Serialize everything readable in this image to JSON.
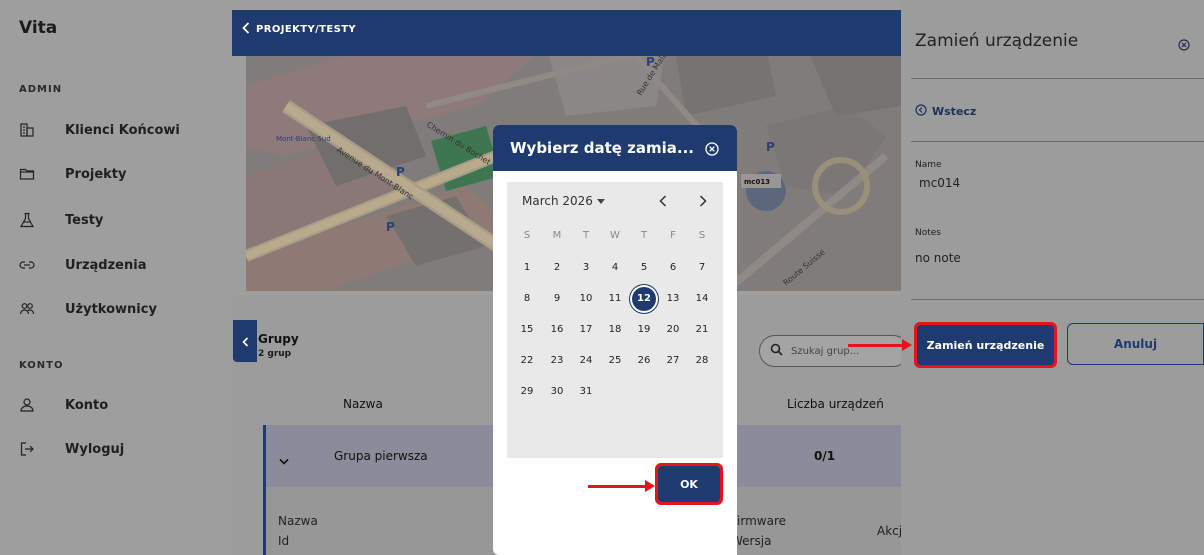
{
  "app": {
    "brand": "Vita"
  },
  "sidebar": {
    "admin_label": "ADMIN",
    "konto_label": "KONTO",
    "items": [
      {
        "label": "Klienci Końcowi",
        "icon": "building-icon"
      },
      {
        "label": "Projekty",
        "icon": "folder-icon"
      },
      {
        "label": "Testy",
        "icon": "flask-icon"
      },
      {
        "label": "Urządzenia",
        "icon": "link-icon"
      },
      {
        "label": "Użytkownicy",
        "icon": "users-icon"
      },
      {
        "label": "Konto",
        "icon": "user-icon"
      },
      {
        "label": "Wyloguj",
        "icon": "logout-icon"
      }
    ]
  },
  "header": {
    "breadcrumb": "PROJEKTY/TESTY"
  },
  "groups": {
    "title": "Grupy",
    "count": "2 grup",
    "search_placeholder": "Szukaj grup...",
    "columns": {
      "name": "Nazwa",
      "device_count": "Liczba urządzeń"
    },
    "rows": [
      {
        "name": "Grupa pierwsza",
        "count": "0/1"
      }
    ],
    "sub_columns": {
      "name": "Nazwa",
      "id": "Id",
      "firmware": "Firmware",
      "version": "Wersja",
      "actions": "Akcje"
    }
  },
  "panel": {
    "title": "Zamień urządzenie",
    "back_label": "Wstecz",
    "name_label": "Name",
    "name_value": "mc014",
    "notes_label": "Notes",
    "notes_value": "no note",
    "confirm_label": "Zamień urządzenie",
    "cancel_label": "Anuluj"
  },
  "modal": {
    "title": "Wybierz datę zamia...",
    "month_label": "March 2026",
    "weekdays": [
      "S",
      "M",
      "T",
      "W",
      "T",
      "F",
      "S"
    ],
    "selected_day": 12,
    "days": [
      [
        "",
        "",
        "",
        "",
        "",
        "",
        ""
      ],
      [
        "1",
        "2",
        "3",
        "4",
        "5",
        "6",
        "7"
      ],
      [
        "8",
        "9",
        "10",
        "11",
        "12",
        "13",
        "14"
      ],
      [
        "15",
        "16",
        "17",
        "18",
        "19",
        "20",
        "21"
      ],
      [
        "22",
        "23",
        "24",
        "25",
        "26",
        "27",
        "28"
      ],
      [
        "29",
        "30",
        "31",
        "",
        "",
        "",
        ""
      ]
    ],
    "ok_label": "OK"
  },
  "map": {
    "labels": [
      "Chemin du Bochet",
      "Avenue du Mont-Blanc",
      "Rue de Malagnou",
      "Route Suisse",
      "Mont-Blanc Sud",
      "mc013"
    ]
  },
  "colors": {
    "primary": "#1f3a6e",
    "annotation": "#e3151b"
  }
}
